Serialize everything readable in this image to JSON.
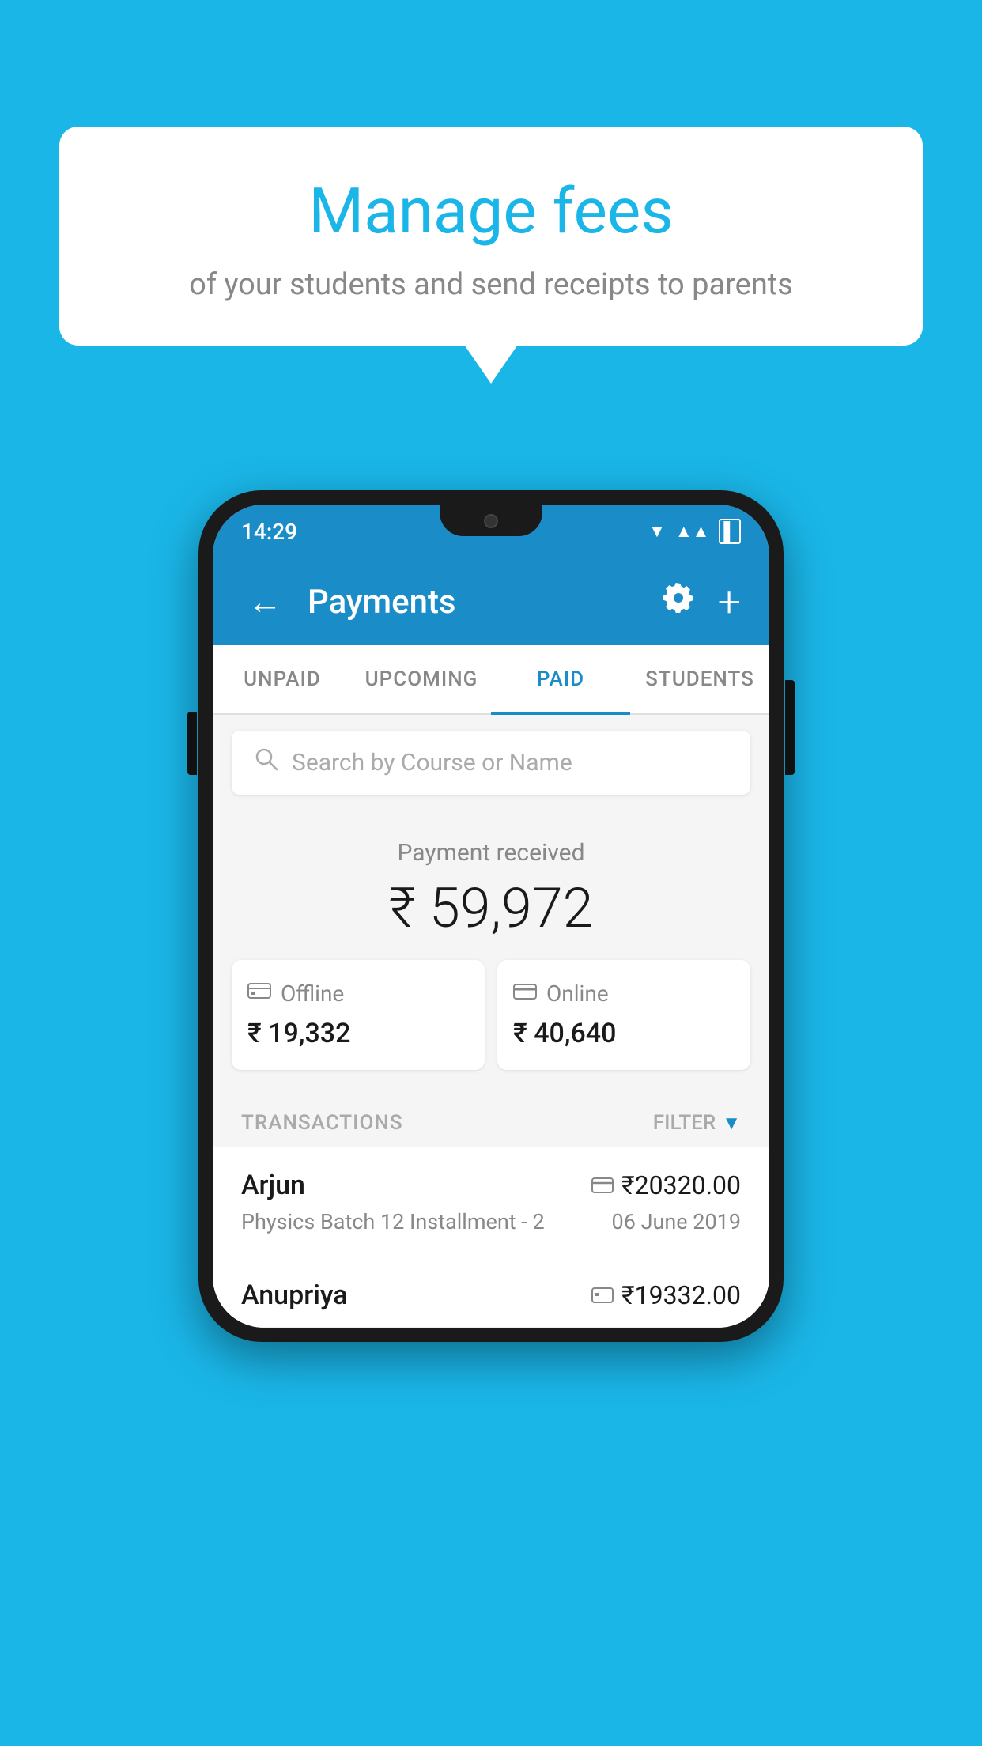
{
  "background_color": "#1ab6e8",
  "speech_bubble": {
    "title": "Manage fees",
    "subtitle": "of your students and send receipts to parents"
  },
  "phone": {
    "status_bar": {
      "time": "14:29",
      "wifi": "▼",
      "signal": "▲",
      "battery": "▌"
    },
    "app_bar": {
      "title": "Payments",
      "back_label": "←",
      "gear_label": "⚙",
      "plus_label": "+"
    },
    "tabs": [
      {
        "id": "unpaid",
        "label": "UNPAID",
        "active": false
      },
      {
        "id": "upcoming",
        "label": "UPCOMING",
        "active": false
      },
      {
        "id": "paid",
        "label": "PAID",
        "active": true
      },
      {
        "id": "students",
        "label": "STUDENTS",
        "active": false
      }
    ],
    "search": {
      "placeholder": "Search by Course or Name"
    },
    "payment_summary": {
      "label": "Payment received",
      "total": "₹ 59,972",
      "offline": {
        "label": "Offline",
        "amount": "₹ 19,332"
      },
      "online": {
        "label": "Online",
        "amount": "₹ 40,640"
      }
    },
    "transactions": {
      "header_label": "TRANSACTIONS",
      "filter_label": "FILTER",
      "items": [
        {
          "name": "Arjun",
          "amount": "₹20320.00",
          "description": "Physics Batch 12 Installment - 2",
          "date": "06 June 2019",
          "payment_type": "card"
        },
        {
          "name": "Anupriya",
          "amount": "₹19332.00",
          "description": "",
          "date": "",
          "payment_type": "cash"
        }
      ]
    }
  }
}
